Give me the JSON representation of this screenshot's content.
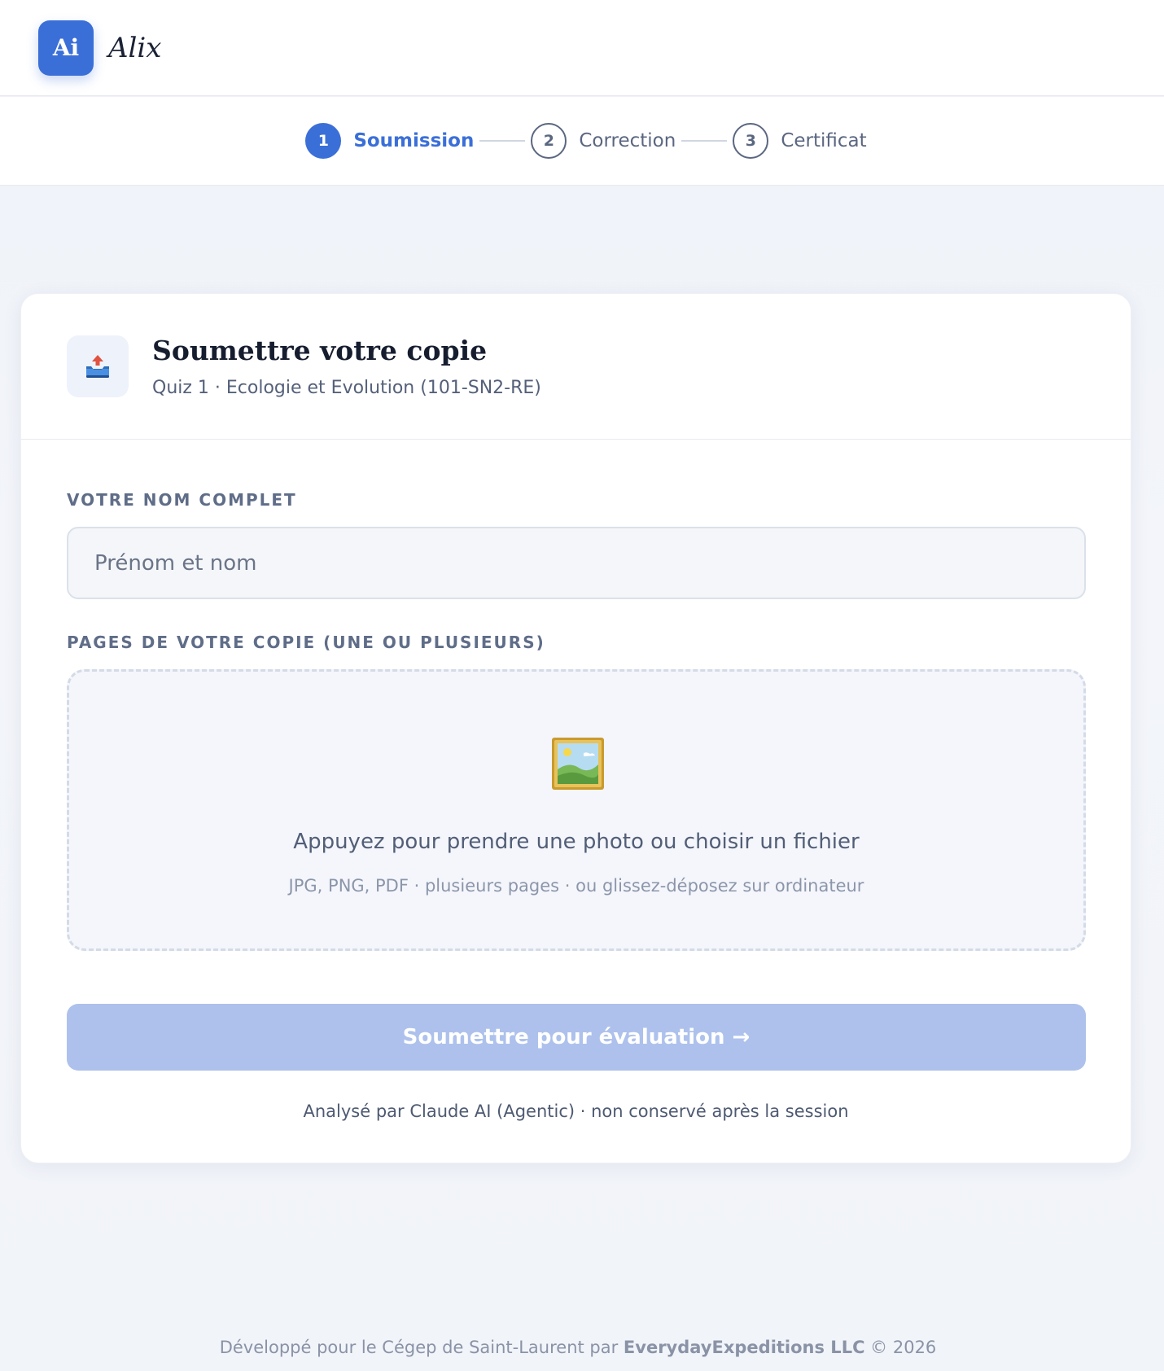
{
  "header": {
    "logo_text": "Ai",
    "brand_name": "Alix"
  },
  "stepper": {
    "steps": [
      {
        "number": "1",
        "label": "Soumission",
        "state": "active"
      },
      {
        "number": "2",
        "label": "Correction",
        "state": "pending"
      },
      {
        "number": "3",
        "label": "Certificat",
        "state": "pending"
      }
    ]
  },
  "card": {
    "icon": "inbox-upload-icon",
    "title": "Soumettre votre copie",
    "subtitle": "Quiz 1 · Ecologie et Evolution (101-SN2-RE)",
    "name_field": {
      "label": "VOTRE NOM COMPLET",
      "placeholder": "Prénom et nom",
      "value": ""
    },
    "pages_field": {
      "label": "PAGES DE VOTRE COPIE (UNE OU PLUSIEURS)",
      "icon": "framed-picture-icon",
      "main_text": "Appuyez pour prendre une photo ou choisir un fichier",
      "hint_text": "JPG, PNG, PDF · plusieurs pages · ou glissez-déposez sur ordinateur"
    },
    "submit_label": "Soumettre pour évaluation →",
    "submit_disabled": true,
    "note": "Analysé par Claude AI (Agentic) · non conservé après la session"
  },
  "footer": {
    "prefix": "Développé pour le Cégep de Saint-Laurent par ",
    "company": "EverydayExpeditions LLC",
    "suffix": " © 2026"
  },
  "colors": {
    "accent": "#3b6fd8",
    "accent_disabled": "#adc1ec",
    "text_muted": "#5f6d88"
  }
}
